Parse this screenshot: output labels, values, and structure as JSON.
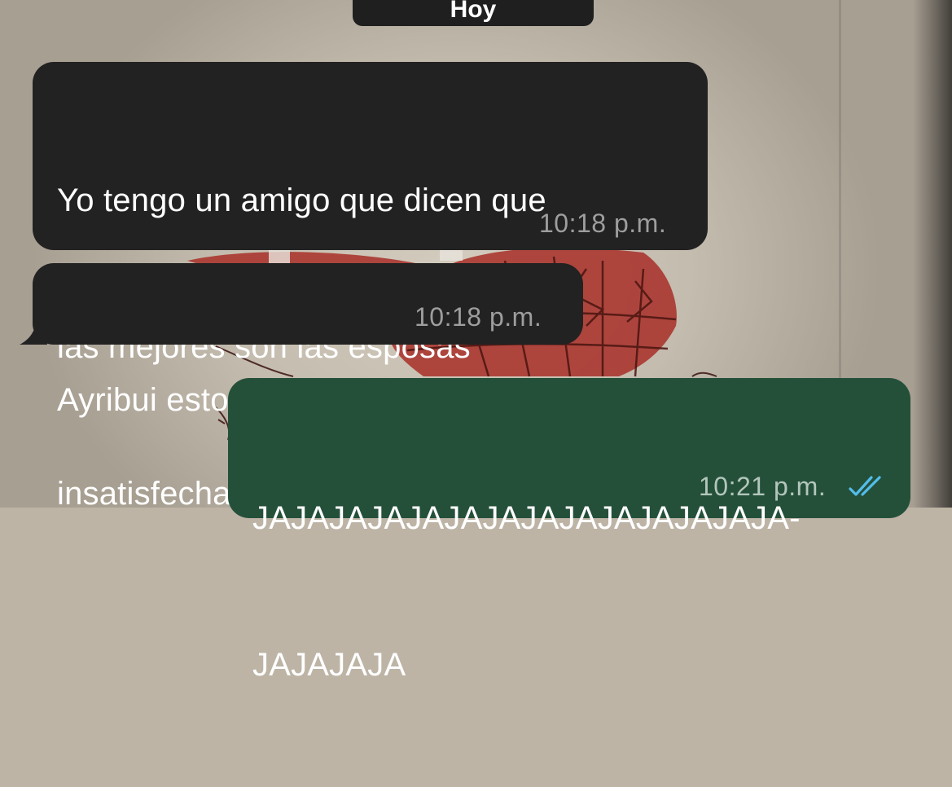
{
  "chat": {
    "date_label": "Hoy",
    "messages": [
      {
        "direction": "incoming",
        "lines": [
          "Yo tengo un amigo que dicen que",
          "las mejores son las esposas",
          "insatisfechas"
        ],
        "time": "10:18 p.m."
      },
      {
        "direction": "incoming",
        "lines": [
          "Ayribui esto a vos"
        ],
        "time": "10:18 p.m."
      },
      {
        "direction": "outgoing",
        "lines": [
          "JAJAJAJAJAJAJAJAJAJAJAJAJAJA-",
          "JAJAJAJA"
        ],
        "time": "10:21 p.m.",
        "status": "read",
        "status_icon": "double-check-icon"
      }
    ]
  },
  "colors": {
    "incoming_bubble": "#222222",
    "outgoing_bubble": "#24503a",
    "read_ticks": "#53bdeb"
  }
}
